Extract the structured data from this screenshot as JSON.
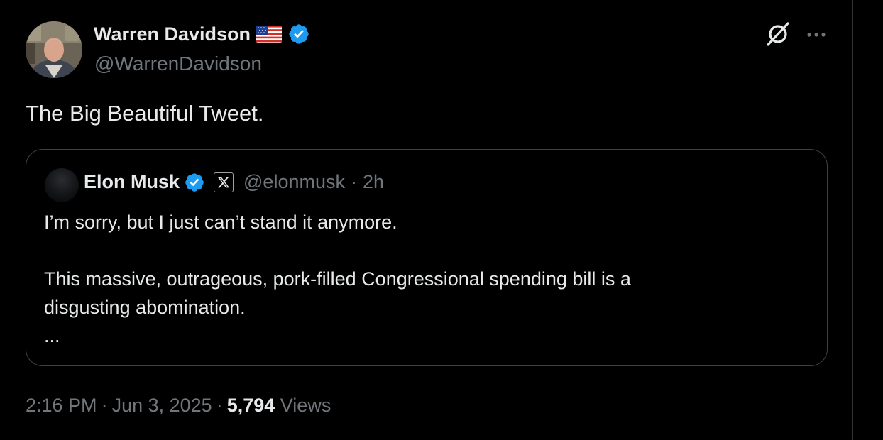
{
  "tweet": {
    "author": {
      "name": "Warren Davidson",
      "handle": "@WarrenDavidson"
    },
    "text": "The Big Beautiful Tweet.",
    "quoted": {
      "author_name": "Elon Musk",
      "handle": "@elonmusk",
      "separator": "·",
      "time": "2h",
      "lines": [
        "I’m sorry, but I just can’t stand it anymore.",
        "This massive, outrageous, pork-filled Congressional spending bill is a",
        "disgusting abomination.",
        "..."
      ]
    },
    "meta": {
      "time": "2:16 PM",
      "sep1": "·",
      "date": "Jun 3, 2025",
      "sep2": "·",
      "views_count": "5,794",
      "views_label": "Views"
    }
  },
  "icons": {
    "verified": "verified-badge-icon",
    "flag": "us-flag-icon",
    "grok": "grok-icon",
    "more": "more-icon",
    "affiliation": "x-logo-icon"
  },
  "colors": {
    "background": "#000000",
    "text": "#e7e9ea",
    "secondary": "#71767b",
    "verified_blue": "#1d9bf0",
    "border": "#3e4144"
  }
}
